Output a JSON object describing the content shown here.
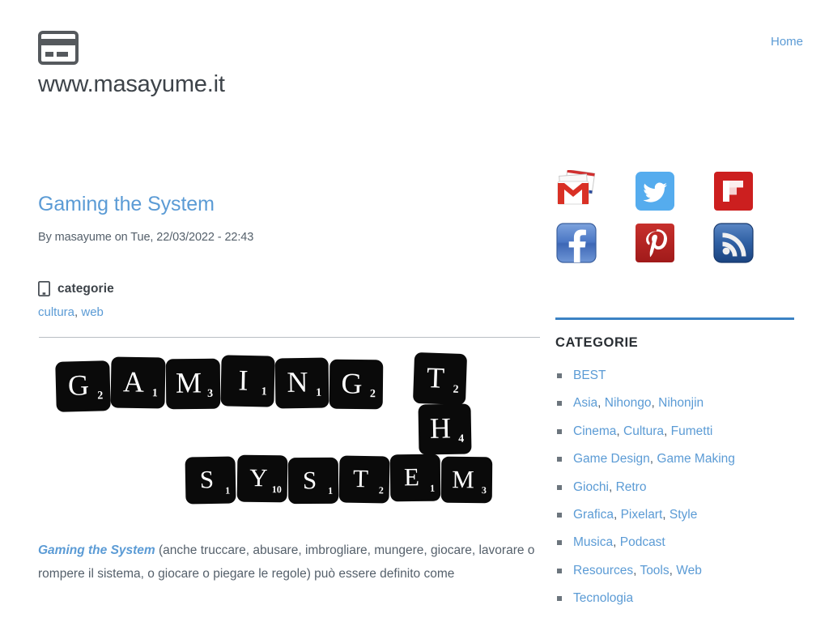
{
  "header": {
    "logo_icon": "credit-card-icon",
    "site_title": "www.masayume.it",
    "nav": [
      {
        "label": "Home"
      }
    ]
  },
  "article": {
    "title": "Gaming the System",
    "byline": "By masayume on Tue, 22/03/2022 - 22:43",
    "categories_icon": "tablet-icon",
    "categories_label": "categorie",
    "categories_links": [
      {
        "label": "cultura"
      },
      {
        "label": "web"
      }
    ],
    "categories_separator": ", ",
    "figure": {
      "alt": "scrabble-tiles-gaming-the-system",
      "tiles_row1": [
        {
          "letter": "G",
          "value": "2"
        },
        {
          "letter": "A",
          "value": "1"
        },
        {
          "letter": "M",
          "value": "3"
        },
        {
          "letter": "I",
          "value": "1"
        },
        {
          "letter": "N",
          "value": "1"
        },
        {
          "letter": "G",
          "value": "2"
        }
      ],
      "tiles_vertical": [
        {
          "letter": "T",
          "value": "2"
        },
        {
          "letter": "H",
          "value": "4"
        }
      ],
      "tiles_row2": [
        {
          "letter": "S",
          "value": "1"
        },
        {
          "letter": "Y",
          "value": "10"
        },
        {
          "letter": "S",
          "value": "1"
        },
        {
          "letter": "T",
          "value": "2"
        },
        {
          "letter": "E",
          "value": "1"
        },
        {
          "letter": "M",
          "value": "3"
        }
      ]
    },
    "body_link": "Gaming the System",
    "body_text": " (anche truccare, abusare, imbrogliare, mungere, giocare, lavorare o rompere il sistema, o giocare o piegare le regole) può essere definito come"
  },
  "sidebar": {
    "social": [
      {
        "name": "gmail-icon",
        "label": "Gmail",
        "color": "#d93025"
      },
      {
        "name": "twitter-icon",
        "label": "Twitter",
        "color": "#55acee"
      },
      {
        "name": "flipboard-icon",
        "label": "Flipboard",
        "color": "#cc1f1f"
      },
      {
        "name": "facebook-icon",
        "label": "Facebook",
        "color": "#4a76c4"
      },
      {
        "name": "pinterest-icon",
        "label": "Pinterest",
        "color": "#bd2026"
      },
      {
        "name": "rss-icon",
        "label": "RSS",
        "color": "#2e5fa3"
      }
    ],
    "categories_title": "CATEGORIE",
    "categories": [
      {
        "links": [
          {
            "label": "BEST"
          }
        ]
      },
      {
        "links": [
          {
            "label": "Asia"
          },
          {
            "label": "Nihongo"
          },
          {
            "label": "Nihonjin"
          }
        ]
      },
      {
        "links": [
          {
            "label": "Cinema"
          },
          {
            "label": "Cultura"
          },
          {
            "label": "Fumetti"
          }
        ]
      },
      {
        "links": [
          {
            "label": "Game Design"
          },
          {
            "label": "Game Making"
          }
        ]
      },
      {
        "links": [
          {
            "label": "Giochi"
          },
          {
            "label": "Retro"
          }
        ]
      },
      {
        "links": [
          {
            "label": "Grafica"
          },
          {
            "label": "Pixelart"
          },
          {
            "label": "Style"
          }
        ]
      },
      {
        "links": [
          {
            "label": "Musica"
          },
          {
            "label": "Podcast"
          }
        ]
      },
      {
        "links": [
          {
            "label": "Resources"
          },
          {
            "label": "Tools"
          },
          {
            "label": "Web"
          }
        ]
      },
      {
        "links": [
          {
            "label": "Tecnologia"
          }
        ]
      }
    ]
  },
  "colors": {
    "link": "#5b9bd5",
    "text": "#55606b",
    "heading": "#2a2f34",
    "accent_rule": "#3b82c4",
    "divider": "#b9bec4",
    "tile_bg": "#0a0a0a"
  }
}
